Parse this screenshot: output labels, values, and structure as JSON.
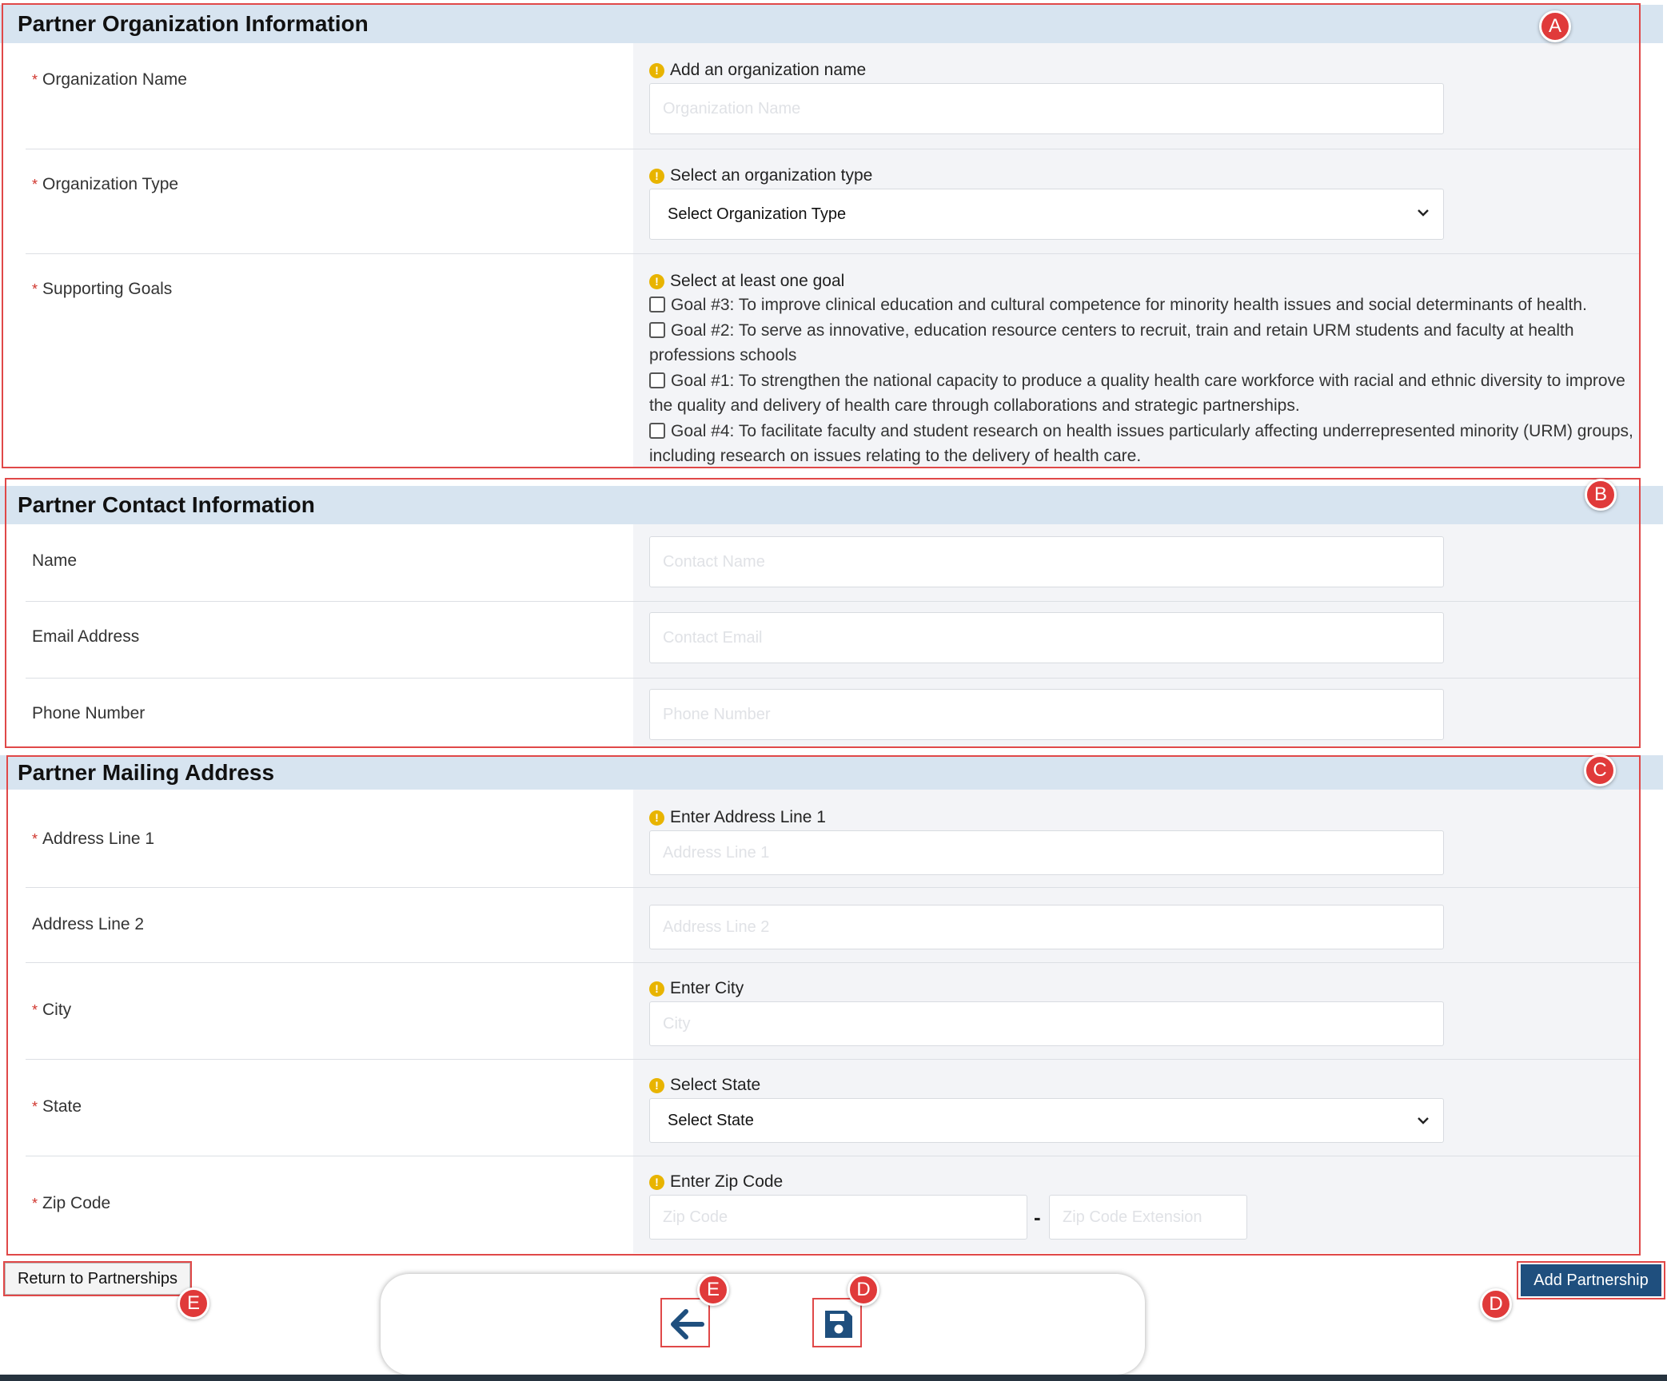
{
  "org_section": {
    "title": "Partner Organization Information",
    "org_name": {
      "label": "Organization Name",
      "hint": "Add an organization name",
      "placeholder": "Organization Name"
    },
    "org_type": {
      "label": "Organization Type",
      "hint": "Select an organization type",
      "value": "Select Organization Type"
    },
    "goals": {
      "label": "Supporting Goals",
      "hint": "Select at least one goal",
      "items": [
        "Goal #3: To improve clinical education and cultural competence for minority health issues and social determinants of health.",
        "Goal #2: To serve as innovative, education resource centers to recruit, train and retain URM students and faculty at health professions schools",
        "Goal #1: To strengthen the national capacity to produce a quality health care workforce with racial and ethnic diversity to improve the quality and delivery of health care through collaborations and strategic partnerships.",
        "Goal #4: To facilitate faculty and student research on health issues particularly affecting underrepresented minority (URM) groups, including research on issues relating to the delivery of health care."
      ]
    }
  },
  "contact_section": {
    "title": "Partner Contact Information",
    "name": {
      "label": "Name",
      "placeholder": "Contact Name"
    },
    "email": {
      "label": "Email Address",
      "placeholder": "Contact Email"
    },
    "phone": {
      "label": "Phone Number",
      "placeholder": "Phone Number"
    }
  },
  "address_section": {
    "title": "Partner Mailing Address",
    "line1": {
      "label": "Address Line 1",
      "hint": "Enter Address Line 1",
      "placeholder": "Address Line 1"
    },
    "line2": {
      "label": "Address Line 2",
      "placeholder": "Address Line 2"
    },
    "city": {
      "label": "City",
      "hint": "Enter City",
      "placeholder": "City"
    },
    "state": {
      "label": "State",
      "hint": "Select State",
      "value": "Select State"
    },
    "zip": {
      "label": "Zip Code",
      "hint": "Enter Zip Code",
      "placeholder": "Zip Code",
      "ext_placeholder": "Zip Code Extension",
      "separator": "-"
    }
  },
  "required_mark": "*",
  "warn_glyph": "!",
  "actions": {
    "return_label": "Return to Partnerships",
    "add_label": "Add Partnership"
  },
  "toolbar": {
    "back_icon": "arrow-left-icon",
    "save_icon": "floppy-disk-icon"
  },
  "annotations": {
    "a": "A",
    "b": "B",
    "c": "C",
    "d": "D",
    "e": "E"
  },
  "colors": {
    "header_bg": "#d7e4f0",
    "required": "#d0342c",
    "warning": "#e8b400",
    "primary_button": "#1f4f7e",
    "annotation": "#e03a3a",
    "icon_blue": "#1f4f7e"
  }
}
